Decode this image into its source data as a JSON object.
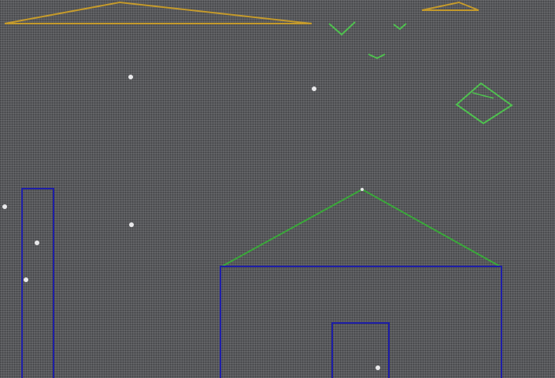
{
  "scene": {
    "background_color": "#57585b",
    "grid_light_color": "#8a8c90",
    "grid_dark_color": "#3c3d40",
    "colors": {
      "mountain": "#c49a2c",
      "roof": "#3aa83a",
      "wall": "#1e1ea8",
      "bird": "#4fc04f",
      "star": "#e8e8ea"
    },
    "objects": [
      {
        "name": "mountain-left",
        "kind": "wireframe-triangle",
        "color_key": "mountain"
      },
      {
        "name": "mountain-right",
        "kind": "wireframe-triangle",
        "color_key": "mountain"
      },
      {
        "name": "bird-1",
        "kind": "v-shape",
        "color_key": "bird"
      },
      {
        "name": "bird-2",
        "kind": "v-shape",
        "color_key": "bird"
      },
      {
        "name": "bird-3",
        "kind": "v-shape",
        "color_key": "bird"
      },
      {
        "name": "kite",
        "kind": "wireframe-diamond",
        "color_key": "bird"
      },
      {
        "name": "tower",
        "kind": "wireframe-rectangle",
        "color_key": "wall"
      },
      {
        "name": "house-roof",
        "kind": "wireframe-triangle",
        "color_key": "roof"
      },
      {
        "name": "house-walls",
        "kind": "wireframe-rectangle",
        "color_key": "wall"
      },
      {
        "name": "house-door",
        "kind": "wireframe-rectangle",
        "color_key": "wall"
      }
    ],
    "star_count": 8
  }
}
